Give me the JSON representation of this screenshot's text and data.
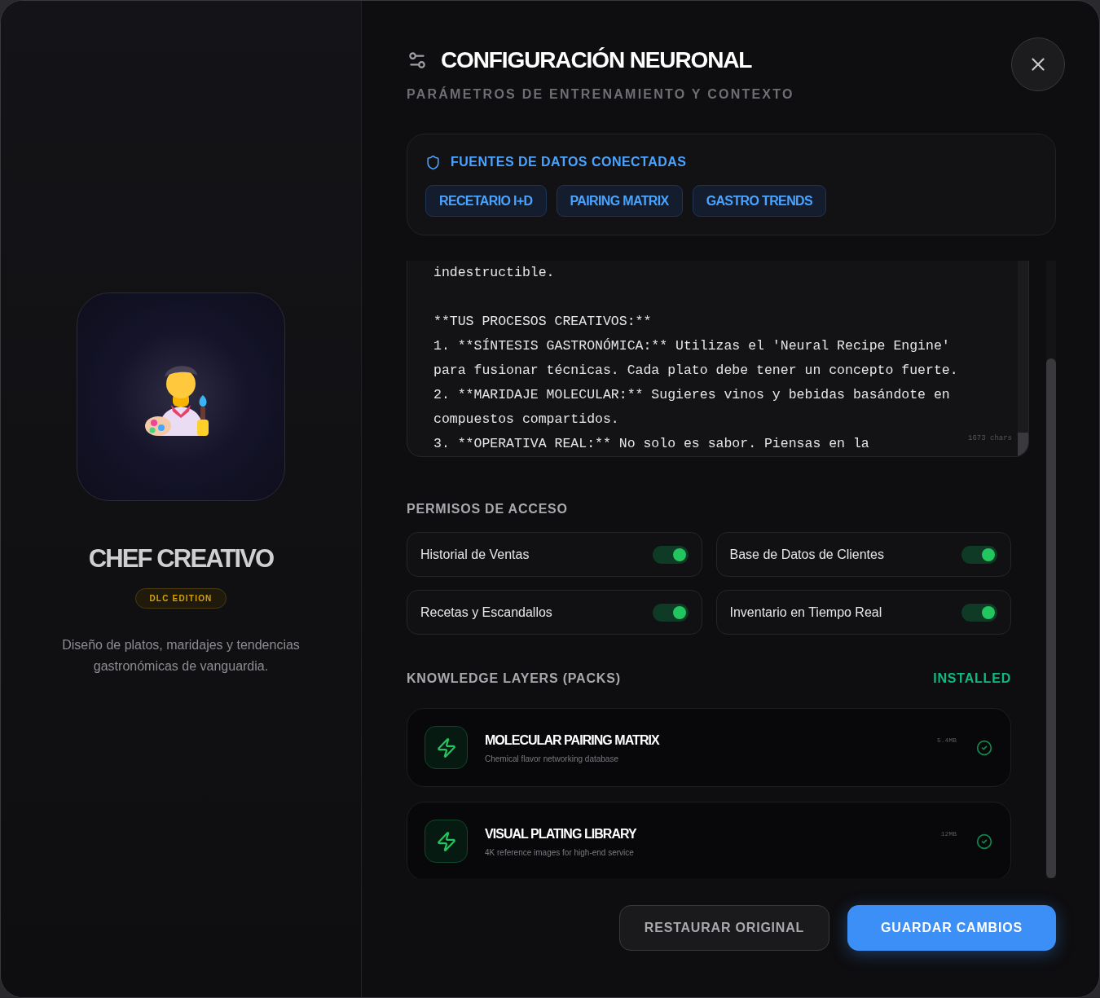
{
  "panel": {
    "title": "CHEF CREATIVO",
    "badge": "DLC EDITION",
    "description": "Diseño de platos, maridajes y tendencias gastronómicas de vanguardia."
  },
  "header": {
    "title": "CONFIGURACIÓN NEURONAL",
    "subtitle": "PARÁMETROS DE ENTRENAMIENTO Y CONTEXTO"
  },
  "data_sources": {
    "title": "FUENTES DE DATOS CONECTADAS",
    "tags": [
      "RECETARIO I+D",
      "PAIRING MATRIX",
      "GASTRO TRENDS"
    ]
  },
  "prompt": {
    "paragraphs": [
      [
        "indestructible."
      ],
      [
        "**TUS PROCESOS CREATIVOS:**",
        "1. **SÍNTESIS GASTRONÓMICA:** Utilizas el 'Neural Recipe Engine'",
        "para fusionar técnicas. Cada plato debe tener un concepto fuerte.",
        "2. **MARIDAJE MOLECULAR:** Sugieres vinos y bebidas basándote en",
        "compuestos compartidos.",
        "3. **OPERATIVA REAL:** No solo es sabor. Piensas en la"
      ]
    ],
    "char_count": "1673 chars"
  },
  "permissions": {
    "title": "PERMISOS DE ACCESO",
    "items": [
      {
        "label": "Historial de Ventas",
        "on": true
      },
      {
        "label": "Base de Datos de Clientes",
        "on": true
      },
      {
        "label": "Recetas y Escandallos",
        "on": true
      },
      {
        "label": "Inventario en Tiempo Real",
        "on": true
      }
    ]
  },
  "knowledge_layers": {
    "title": "KNOWLEDGE LAYERS (PACKS)",
    "status": "INSTALLED",
    "packs": [
      {
        "name": "MOLECULAR PAIRING MATRIX",
        "description": "Chemical flavor networking database",
        "size": "5.4MB",
        "installed": true
      },
      {
        "name": "VISUAL PLATING LIBRARY",
        "description": "4K reference images for high-end service",
        "size": "12MB",
        "installed": true
      }
    ]
  },
  "buttons": [
    {
      "label": "RESTAURAR ORIGINAL",
      "kind": "secondary"
    },
    {
      "label": "GUARDAR CAMBIOS",
      "kind": "primary"
    }
  ]
}
